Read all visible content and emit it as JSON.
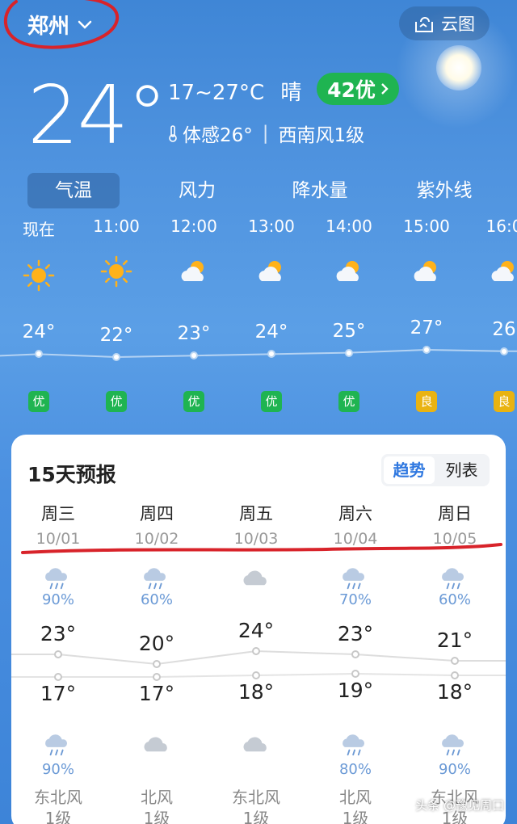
{
  "header": {
    "city": "郑州",
    "cloud_map_label": "云图"
  },
  "current": {
    "temperature": "24°",
    "range": "17~27°C",
    "condition": "晴",
    "aqi_label": "42优",
    "feels_like": "体感26°",
    "wind": "西南风1级"
  },
  "tabs": [
    {
      "label": "气温",
      "active": true
    },
    {
      "label": "风力",
      "active": false
    },
    {
      "label": "降水量",
      "active": false
    },
    {
      "label": "紫外线",
      "active": false
    }
  ],
  "hourly": [
    {
      "time": "现在",
      "icon": "sun-icon",
      "temp": "24°",
      "aqi": "优",
      "aqi_color": "#1fb451"
    },
    {
      "time": "11:00",
      "icon": "sun-icon",
      "temp": "22°",
      "aqi": "优",
      "aqi_color": "#1fb451"
    },
    {
      "time": "12:00",
      "icon": "partly-cloudy-icon",
      "temp": "23°",
      "aqi": "优",
      "aqi_color": "#1fb451"
    },
    {
      "time": "13:00",
      "icon": "partly-cloudy-icon",
      "temp": "24°",
      "aqi": "优",
      "aqi_color": "#1fb451"
    },
    {
      "time": "14:00",
      "icon": "partly-cloudy-icon",
      "temp": "25°",
      "aqi": "优",
      "aqi_color": "#1fb451"
    },
    {
      "time": "15:00",
      "icon": "partly-cloudy-icon",
      "temp": "27°",
      "aqi": "良",
      "aqi_color": "#e9b312"
    },
    {
      "time": "16:0",
      "icon": "partly-cloudy-icon",
      "temp": "26",
      "aqi": "良",
      "aqi_color": "#e9b312"
    }
  ],
  "forecast": {
    "title": "15天预报",
    "toggle": {
      "trend": "趋势",
      "list": "列表"
    },
    "days": [
      {
        "weekday": "周三",
        "date": "10/01",
        "day_icon": "rain-icon",
        "day_precip": "90%",
        "high": "23°",
        "low": "17°",
        "night_icon": "rain-icon",
        "night_precip": "90%",
        "wind_dir": "东北风",
        "wind_level": "1级"
      },
      {
        "weekday": "周四",
        "date": "10/02",
        "day_icon": "rain-icon",
        "day_precip": "60%",
        "high": "20°",
        "low": "17°",
        "night_icon": "cloud-icon",
        "night_precip": "",
        "wind_dir": "北风",
        "wind_level": "1级"
      },
      {
        "weekday": "周五",
        "date": "10/03",
        "day_icon": "cloud-icon",
        "day_precip": "",
        "high": "24°",
        "low": "18°",
        "night_icon": "cloud-icon",
        "night_precip": "",
        "wind_dir": "东北风",
        "wind_level": "1级"
      },
      {
        "weekday": "周六",
        "date": "10/04",
        "day_icon": "rain-icon",
        "day_precip": "70%",
        "high": "23°",
        "low": "19°",
        "night_icon": "rain-icon",
        "night_precip": "80%",
        "wind_dir": "北风",
        "wind_level": "1级"
      },
      {
        "weekday": "周日",
        "date": "10/05",
        "day_icon": "rain-icon",
        "day_precip": "60%",
        "high": "21°",
        "low": "18°",
        "night_icon": "rain-icon",
        "night_precip": "90%",
        "wind_dir": "东北风",
        "wind_level": "1级"
      }
    ]
  },
  "watermark": "头条 @豫见周口"
}
